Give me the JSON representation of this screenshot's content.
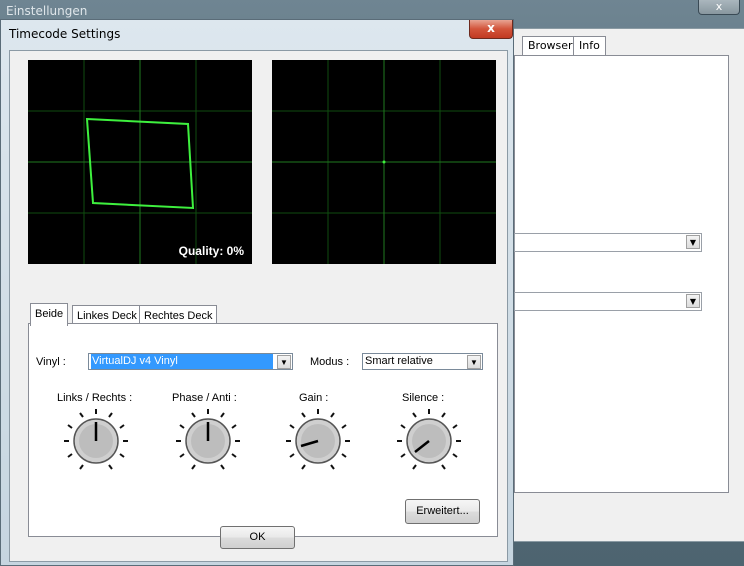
{
  "background_window": {
    "title": "Einstellungen",
    "tabs": [
      "Browser",
      "Info"
    ]
  },
  "dialog": {
    "title": "Timecode Settings",
    "close_label": "x",
    "quality_label": "Quality: 0%",
    "tabs": [
      "Beide",
      "Linkes Deck",
      "Rechtes Deck"
    ],
    "vinyl_label": "Vinyl :",
    "vinyl_value": "VirtualDJ v4 Vinyl",
    "modus_label": "Modus :",
    "modus_value": "Smart relative",
    "knobs": [
      {
        "label": "Links / Rechts :"
      },
      {
        "label": "Phase / Anti :"
      },
      {
        "label": "Gain :"
      },
      {
        "label": "Silence :"
      }
    ],
    "advanced_button": "Erweitert...",
    "ok_button": "OK"
  }
}
